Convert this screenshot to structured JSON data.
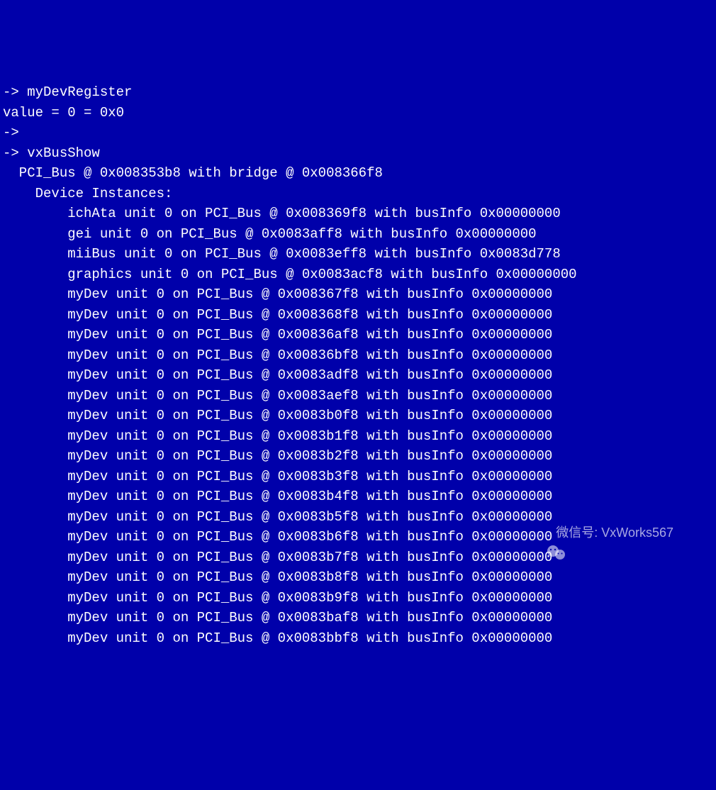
{
  "terminal": {
    "lines": [
      "-> myDevRegister",
      "value = 0 = 0x0",
      "->",
      "-> vxBusShow",
      "  PCI_Bus @ 0x008353b8 with bridge @ 0x008366f8",
      "    Device Instances:",
      "        ichAta unit 0 on PCI_Bus @ 0x008369f8 with busInfo 0x00000000",
      "        gei unit 0 on PCI_Bus @ 0x0083aff8 with busInfo 0x00000000",
      "        miiBus unit 0 on PCI_Bus @ 0x0083eff8 with busInfo 0x0083d778",
      "        graphics unit 0 on PCI_Bus @ 0x0083acf8 with busInfo 0x00000000",
      "        myDev unit 0 on PCI_Bus @ 0x008367f8 with busInfo 0x00000000",
      "        myDev unit 0 on PCI_Bus @ 0x008368f8 with busInfo 0x00000000",
      "        myDev unit 0 on PCI_Bus @ 0x00836af8 with busInfo 0x00000000",
      "        myDev unit 0 on PCI_Bus @ 0x00836bf8 with busInfo 0x00000000",
      "        myDev unit 0 on PCI_Bus @ 0x0083adf8 with busInfo 0x00000000",
      "        myDev unit 0 on PCI_Bus @ 0x0083aef8 with busInfo 0x00000000",
      "        myDev unit 0 on PCI_Bus @ 0x0083b0f8 with busInfo 0x00000000",
      "        myDev unit 0 on PCI_Bus @ 0x0083b1f8 with busInfo 0x00000000",
      "        myDev unit 0 on PCI_Bus @ 0x0083b2f8 with busInfo 0x00000000",
      "        myDev unit 0 on PCI_Bus @ 0x0083b3f8 with busInfo 0x00000000",
      "        myDev unit 0 on PCI_Bus @ 0x0083b4f8 with busInfo 0x00000000",
      "        myDev unit 0 on PCI_Bus @ 0x0083b5f8 with busInfo 0x00000000",
      "        myDev unit 0 on PCI_Bus @ 0x0083b6f8 with busInfo 0x00000000",
      "        myDev unit 0 on PCI_Bus @ 0x0083b7f8 with busInfo 0x00000000",
      "        myDev unit 0 on PCI_Bus @ 0x0083b8f8 with busInfo 0x00000000",
      "        myDev unit 0 on PCI_Bus @ 0x0083b9f8 with busInfo 0x00000000",
      "        myDev unit 0 on PCI_Bus @ 0x0083baf8 with busInfo 0x00000000",
      "        myDev unit 0 on PCI_Bus @ 0x0083bbf8 with busInfo 0x00000000"
    ]
  },
  "watermark": {
    "text": "微信号: VxWorks567"
  }
}
